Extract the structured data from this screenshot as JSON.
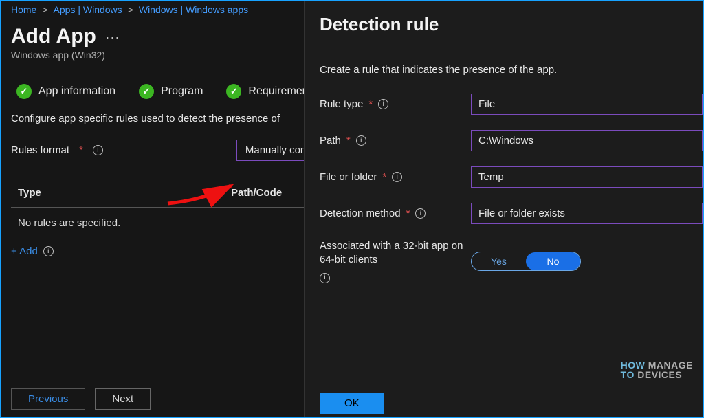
{
  "breadcrumbs": [
    "Home",
    "Apps | Windows",
    "Windows | Windows apps"
  ],
  "page": {
    "title": "Add App",
    "subtitle": "Windows app (Win32)",
    "more_label": "..."
  },
  "wizard_steps": [
    "App information",
    "Program",
    "Requirements"
  ],
  "description": "Configure app specific rules used to detect the presence of",
  "rules_format": {
    "label": "Rules format",
    "value": "Manually conf"
  },
  "rules_table": {
    "col_type": "Type",
    "col_path": "Path/Code",
    "empty": "No rules are specified.",
    "add_label": "+ Add"
  },
  "footer": {
    "previous": "Previous",
    "next": "Next"
  },
  "panel": {
    "title": "Detection rule",
    "desc": "Create a rule that indicates the presence of the app.",
    "fields": {
      "rule_type": {
        "label": "Rule type",
        "value": "File"
      },
      "path": {
        "label": "Path",
        "value": "C:\\Windows"
      },
      "file_or_folder": {
        "label": "File or folder",
        "value": "Temp"
      },
      "detection_method": {
        "label": "Detection method",
        "value": "File or folder exists"
      },
      "assoc32": {
        "label": "Associated with a 32-bit app on 64-bit clients",
        "yes": "Yes",
        "no": "No",
        "selected": "No"
      }
    },
    "ok": "OK"
  },
  "watermark": {
    "l1": "HOW",
    "l2": "MANAGE",
    "l3": "TO",
    "l4": "DEVICES"
  }
}
